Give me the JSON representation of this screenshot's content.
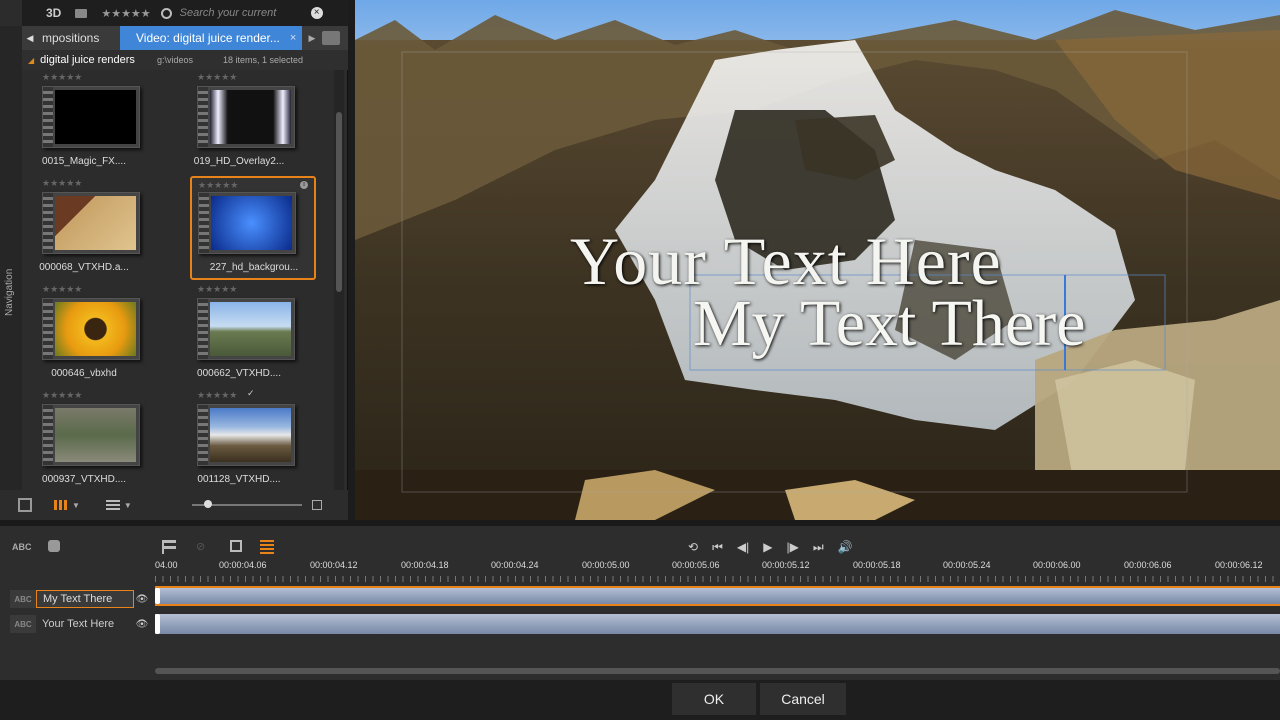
{
  "library": {
    "nav_label": "Navigation",
    "top": {
      "label_3d": "3D",
      "stars": "★★★★★",
      "search_placeholder": "Search your current",
      "clear": "×"
    },
    "tabs": {
      "left_tab": "mpositions",
      "active_tab": "Video: digital juice render...",
      "close": "×"
    },
    "path": {
      "folder": "digital juice renders",
      "sub": "g:\\videos",
      "count": "18 items, 1 selected"
    },
    "clips": [
      {
        "name": "0015_Magic_FX....",
        "rating": "★★★★★"
      },
      {
        "name": "019_HD_Overlay2...",
        "rating": "★★★★★"
      },
      {
        "name": "000068_VTXHD.a...",
        "rating": "★★★★★"
      },
      {
        "name": "227_hd_backgrou...",
        "rating": "★★★★★",
        "selected": true
      },
      {
        "name": "000646_vbxhd",
        "rating": "★★★★★"
      },
      {
        "name": "000662_VTXHD....",
        "rating": "★★★★★"
      },
      {
        "name": "000937_VTXHD....",
        "rating": "★★★★★"
      },
      {
        "name": "001128_VTXHD....",
        "rating": "★★★★★",
        "check": "✓"
      }
    ]
  },
  "preview": {
    "title_line1": "Your Text Here",
    "title_line2": "My Text There"
  },
  "timeline": {
    "abc_label": "ABC",
    "timecodes": [
      "04.00",
      "00:00:04.06",
      "00:00:04.12",
      "00:00:04.18",
      "00:00:04.24",
      "00:00:05.00",
      "00:00:05.06",
      "00:00:05.12",
      "00:00:05.18",
      "00:00:05.24",
      "00:00:06.00",
      "00:00:06.06",
      "00:00:06.12"
    ],
    "tracks": [
      {
        "name": "My Text There",
        "active": true
      },
      {
        "name": "Your Text Here",
        "active": false
      }
    ],
    "eye": "👁",
    "play_icons": {
      "loop": "⟲",
      "start": "⏮",
      "back": "◀|",
      "play": "▶",
      "fwd": "|▶",
      "end": "⏭",
      "vol": "🔊"
    }
  },
  "footer": {
    "ok": "OK",
    "cancel": "Cancel"
  },
  "colors": {
    "accent": "#e8831a",
    "tab_blue": "#3f86d8"
  }
}
